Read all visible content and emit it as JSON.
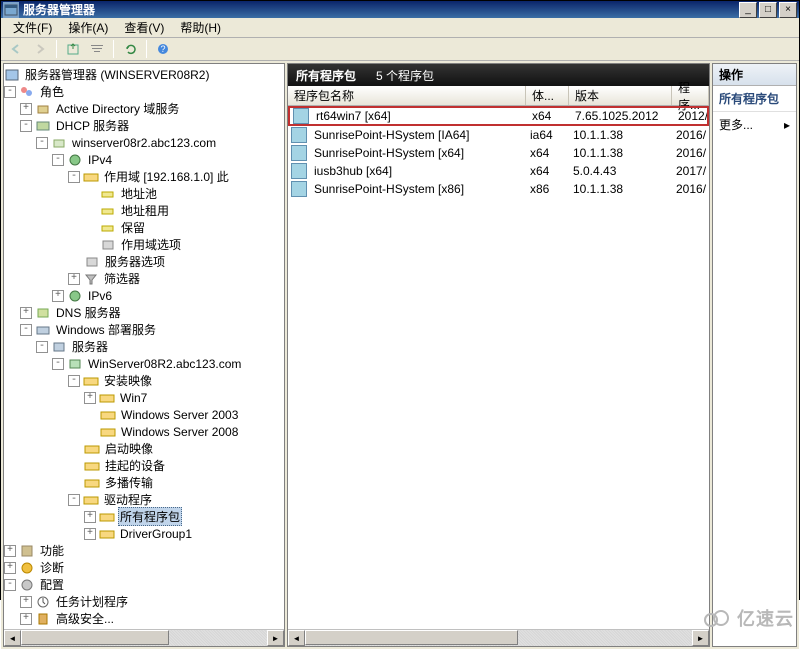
{
  "window": {
    "title": "服务器管理器",
    "min": "_",
    "max": "□",
    "close": "×"
  },
  "menu": {
    "file": "文件(F)",
    "action": "操作(A)",
    "view": "查看(V)",
    "help": "帮助(H)"
  },
  "tree": {
    "root": "服务器管理器 (WINSERVER08R2)",
    "roles": "角色",
    "ad": "Active Directory 域服务",
    "dhcp": "DHCP 服务器",
    "dhcpsrv": "winserver08r2.abc123.com",
    "ipv4": "IPv4",
    "scope": "作用域 [192.168.1.0] 此",
    "pool": "地址池",
    "lease": "地址租用",
    "reserve": "保留",
    "scopeopt": "作用域选项",
    "srvopt": "服务器选项",
    "filter": "筛选器",
    "ipv6": "IPv6",
    "dns": "DNS 服务器",
    "wds": "Windows 部署服务",
    "servers": "服务器",
    "wdssrv": "WinServer08R2.abc123.com",
    "install": "安装映像",
    "win7": "Win7",
    "ws2003": "Windows Server 2003",
    "ws2008": "Windows Server 2008",
    "boot": "启动映像",
    "pending": "挂起的设备",
    "multicast": "多播传输",
    "drivers": "驱动程序",
    "allpkg": "所有程序包",
    "drvgrp": "DriverGroup1",
    "features": "功能",
    "diag": "诊断",
    "config": "配置",
    "task": "任务计划程序",
    "last": "高级安全..."
  },
  "list": {
    "title": "所有程序包",
    "count": "5 个程序包",
    "col_name": "程序包名称",
    "col_arch": "体...",
    "col_ver": "版本",
    "col_date": "程序...",
    "rows": [
      {
        "name": "rt64win7 [x64]",
        "arch": "x64",
        "ver": "7.65.1025.2012",
        "date": "2012/",
        "hl": true
      },
      {
        "name": "SunrisePoint-HSystem [IA64]",
        "arch": "ia64",
        "ver": "10.1.1.38",
        "date": "2016/",
        "hl": false
      },
      {
        "name": "SunrisePoint-HSystem [x64]",
        "arch": "x64",
        "ver": "10.1.1.38",
        "date": "2016/",
        "hl": false
      },
      {
        "name": "iusb3hub [x64]",
        "arch": "x64",
        "ver": "5.0.4.43",
        "date": "2017/",
        "hl": false
      },
      {
        "name": "SunrisePoint-HSystem [x86]",
        "arch": "x86",
        "ver": "10.1.1.38",
        "date": "2016/",
        "hl": false
      }
    ]
  },
  "actions": {
    "header": "操作",
    "section": "所有程序包",
    "more": "更多..."
  },
  "watermark": "亿速云"
}
